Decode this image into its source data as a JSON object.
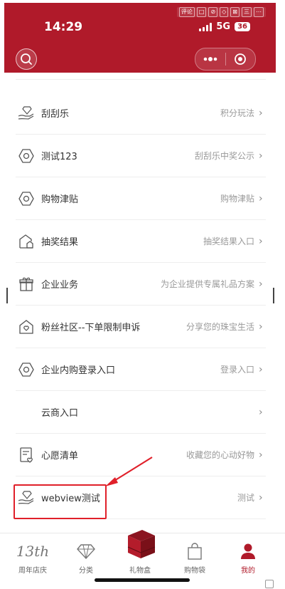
{
  "status_bar": {
    "time": "14:29",
    "network": "5G",
    "battery": "36",
    "mini_icons": [
      "评论",
      "□",
      "⊘",
      "◇",
      "⊠",
      "三",
      "⋯"
    ]
  },
  "list": {
    "items": [
      {
        "label": "刮刮乐",
        "hint": "积分玩法",
        "icon": "diamond-hand-icon"
      },
      {
        "label": "测试123",
        "hint": "刮刮乐中奖公示",
        "icon": "hexagon-icon"
      },
      {
        "label": "购物津贴",
        "hint": "购物津贴",
        "icon": "hexagon-icon"
      },
      {
        "label": "抽奖结果",
        "hint": "抽奖结果入口",
        "icon": "house-icon"
      },
      {
        "label": "企业业务",
        "hint": "为企业提供专属礼品方案",
        "icon": "gift-icon"
      },
      {
        "label": "粉丝社区--下单限制申诉",
        "hint": "分享您的珠宝生活",
        "icon": "heart-house-icon"
      },
      {
        "label": "企业内购登录入口",
        "hint": "登录入口",
        "icon": "hexagon-icon"
      },
      {
        "label": "云商入口",
        "hint": "",
        "icon": ""
      },
      {
        "label": "心愿清单",
        "hint": "收藏您的心动好物",
        "icon": "wishlist-icon"
      },
      {
        "label": "webview测试",
        "hint": "测试",
        "icon": "diamond-hand-icon"
      }
    ],
    "chevron": "›"
  },
  "tabbar": {
    "tabs": [
      {
        "label": "周年店庆",
        "icon": "anniversary-icon",
        "badge": "13th"
      },
      {
        "label": "分类",
        "icon": "diamond-icon"
      },
      {
        "label": "礼物盒",
        "icon": "gift-box-icon"
      },
      {
        "label": "购物袋",
        "icon": "bag-icon"
      },
      {
        "label": "我的",
        "icon": "person-icon"
      }
    ],
    "active_index": 4
  },
  "colors": {
    "brand": "#b01a2a",
    "highlight": "#e0202a"
  }
}
